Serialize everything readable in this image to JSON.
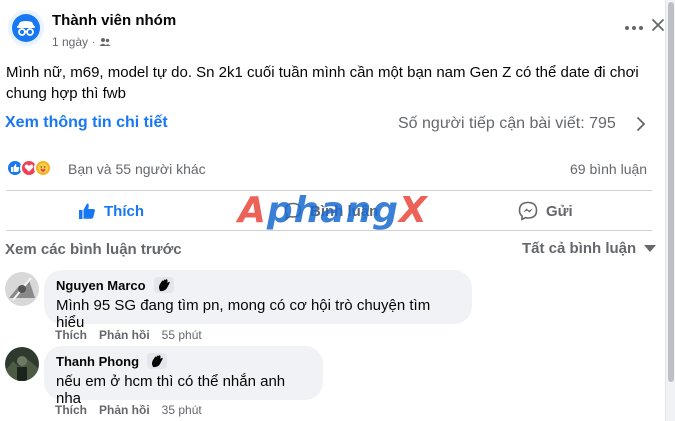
{
  "post": {
    "group_name": "Thành viên nhóm",
    "time": "1 ngày",
    "dot": "·",
    "text": "Mình nữ, m69, model tự do. Sn 2k1 cuối tuần mình cần một bạn nam Gen Z có thể date đi chơi chung hợp thì fwb",
    "view_details": "Xem thông tin chi tiết",
    "reach": "Số người tiếp cận bài viết: 795",
    "reactions_text": "Bạn và 55 người khác",
    "comment_count": "69 bình luận"
  },
  "actions": {
    "like": "Thích",
    "comment": "Bình luận",
    "send": "Gửi"
  },
  "watermark": {
    "first": "A",
    "middle": "phang",
    "last": "X"
  },
  "comments_header": {
    "previous": "Xem các bình luận trước",
    "filter": "Tất cả bình luận"
  },
  "comments": [
    {
      "author": "Nguyen Marco",
      "text": "Mình 95 SG đang tìm pn, mong có cơ hội trò chuyện tìm hiểu",
      "like": "Thích",
      "reply": "Phản hồi",
      "time": "55 phút"
    },
    {
      "author": "Thanh Phong",
      "text": "nếu em ở hcm thì có thể nhắn anh nha",
      "like": "Thích",
      "reply": "Phản hồi",
      "time": "35 phút"
    }
  ],
  "colors": {
    "accent": "#1877f2",
    "secondary_text": "#65676b",
    "bubble": "#f0f2f5"
  },
  "icons": {
    "group_avatar": "incognito-member-icon",
    "privacy": "group-privacy-icon",
    "more": "more-dots-icon",
    "close": "close-icon",
    "chevron": "chevron-right-icon",
    "like": "thumbs-up-icon",
    "comment": "comment-bubble-icon",
    "send": "messenger-icon",
    "badge": "waving-hand-icon"
  }
}
